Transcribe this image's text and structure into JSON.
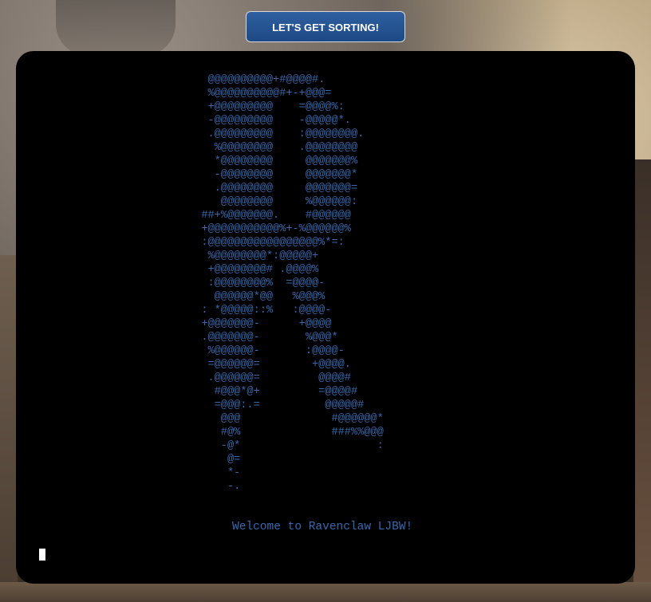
{
  "button": {
    "label": "LET'S GET SORTING!"
  },
  "terminal": {
    "ascii_art": "   @@@@@@@@@@+#@@@@#.\n   %@@@@@@@@@@#+-+@@@=\n   +@@@@@@@@@    =@@@@%:\n   -@@@@@@@@@    -@@@@@*.\n   .@@@@@@@@@    :@@@@@@@@.\n    %@@@@@@@@    .@@@@@@@@\n    *@@@@@@@@     @@@@@@@%\n    -@@@@@@@@     @@@@@@@*\n    .@@@@@@@@     @@@@@@@=\n     @@@@@@@@     %@@@@@@:\n  ##+%@@@@@@@.    #@@@@@@\n  +@@@@@@@@@@@%+-%@@@@@@%\n  :@@@@@@@@@@@@@@@@@%*=:\n   %@@@@@@@@*:@@@@@+\n   +@@@@@@@@# .@@@@%\n   :@@@@@@@@%  =@@@@-\n    @@@@@@*@@   %@@@%\n  : *@@@@@::%   :@@@@-\n  +@@@@@@@-      +@@@@\n  .@@@@@@@-       %@@@*\n   %@@@@@@-       :@@@@-\n   =@@@@@@=        +@@@@.\n   .@@@@@@=         @@@@#\n    #@@@*@+         =@@@@#\n    =@@@:.=          @@@@@#\n     @@@              #@@@@@@*\n     #@%              ###%%@@@\n     -@*                     :\n      @=\n      *-\n      -.",
    "welcome_text": "Welcome to Ravenclaw LJBW!",
    "text_color": "#3a68ab"
  }
}
